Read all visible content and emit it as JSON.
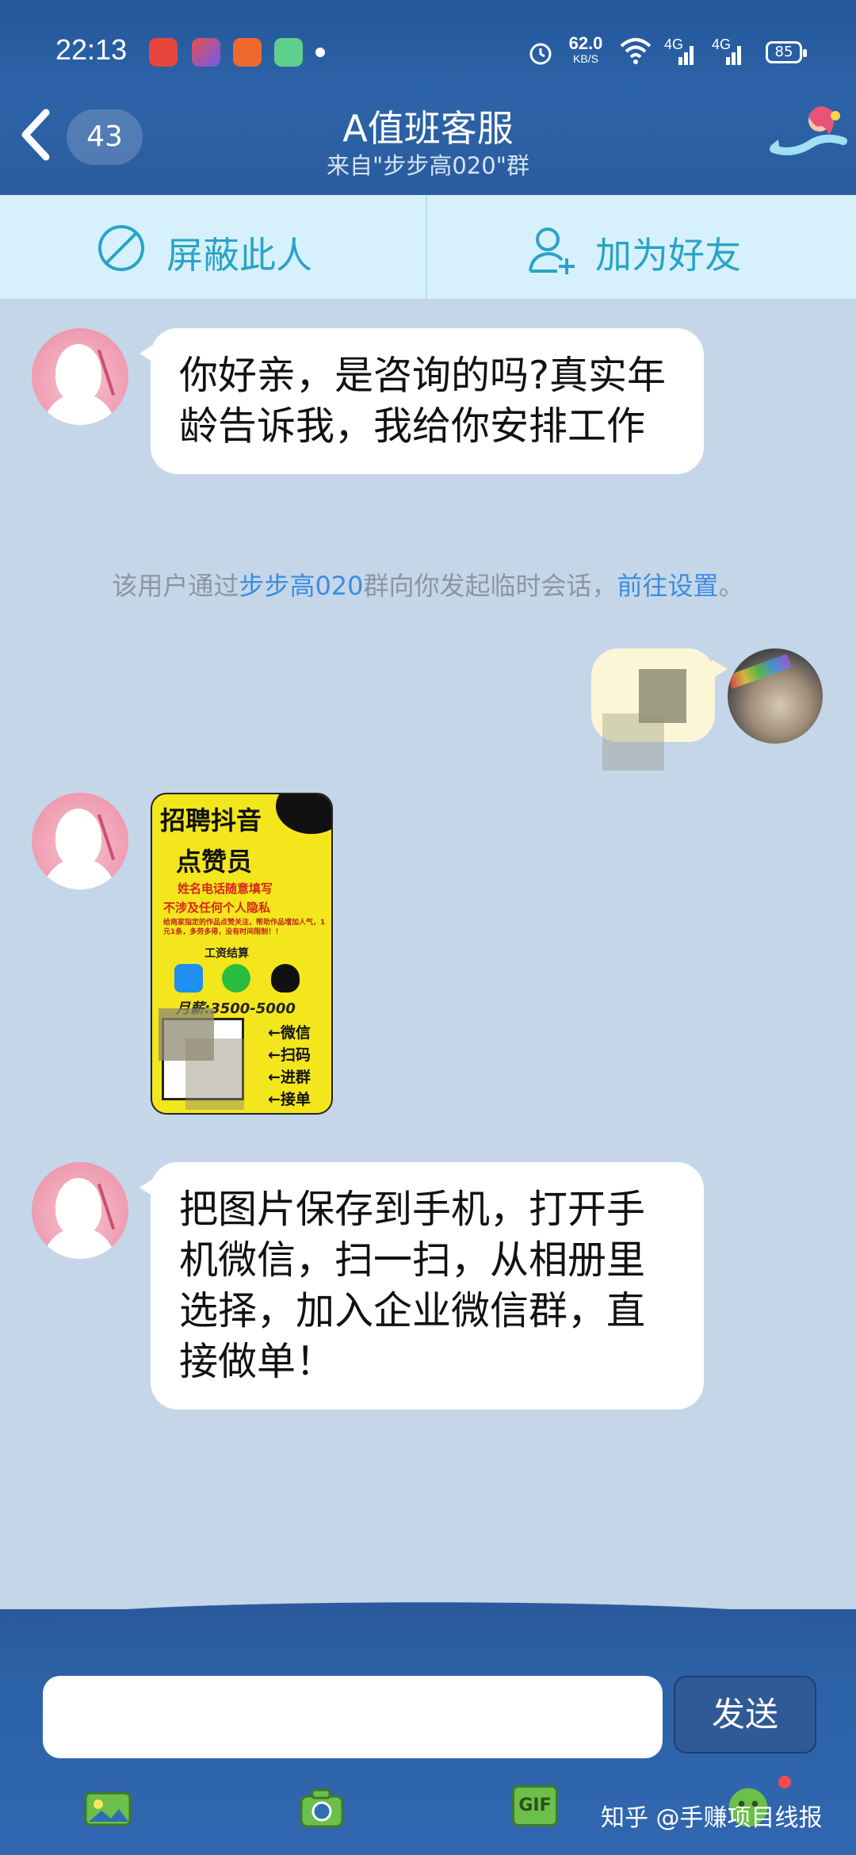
{
  "status_bar": {
    "time": "22:13",
    "net_speed_value": "62.0",
    "net_speed_unit": "KB/S",
    "signal1": "4G",
    "signal2": "4G",
    "battery": "85"
  },
  "header": {
    "unread_count": "43",
    "title": "A值班客服",
    "subtitle": "来自\"步步高020\"群"
  },
  "actions": {
    "block_label": "屏蔽此人",
    "add_friend_label": "加为好友"
  },
  "messages": {
    "msg1": "你好亲，是咨询的吗?真实年龄告诉我，我给你安排工作",
    "msg3": "把图片保存到手机，打开手机微信，扫一扫，从相册里选择，加入企业微信群，直接做单！"
  },
  "system_note": {
    "prefix": "该用户通过",
    "group_link": "步步高020",
    "middle": "群向你发起临时会话，",
    "settings_link": "前往设置",
    "suffix": "。"
  },
  "poster": {
    "line1": "招聘抖音",
    "line2": "点赞员",
    "red1": "姓名电话随意填写",
    "red2": "不涉及任何个人隐私",
    "desc": "给商家指定的作品点赞关注，帮助作品增加人气，1元1条，多劳多得，没有时间限制！！",
    "pay_label": "工资结算",
    "salary": "月薪:3500-5000",
    "arrow1": "←微信",
    "arrow2": "←扫码",
    "arrow3": "←进群",
    "arrow4": "←接单"
  },
  "composer": {
    "send_label": "发送",
    "gif_label": "GIF"
  },
  "watermark": "知乎 @手赚项目线报",
  "colors": {
    "header_bg": "#2d63a8",
    "action_bar_bg": "#d6f1fb",
    "action_text": "#2aa3c7",
    "chat_bg": "#c5d6e8",
    "link": "#3a8de0"
  }
}
